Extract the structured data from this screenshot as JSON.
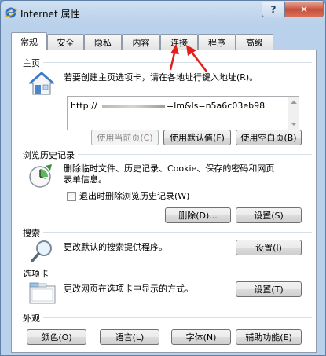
{
  "window": {
    "title": "Internet 属性",
    "help_label": "?",
    "close_label": "✕"
  },
  "tabs": [
    {
      "label": "常规",
      "active": true
    },
    {
      "label": "安全",
      "active": false
    },
    {
      "label": "隐私",
      "active": false
    },
    {
      "label": "内容",
      "active": false
    },
    {
      "label": "连接",
      "active": false
    },
    {
      "label": "程序",
      "active": false
    },
    {
      "label": "高级",
      "active": false
    }
  ],
  "home": {
    "section_title": "主页",
    "description": "若要创建主页选项卡，请在各地址行键入地址(R)。",
    "url_prefix": "http://",
    "url_suffix": "=lm&ls=n5a6c03eb98",
    "btn_current": "使用当前页(C)",
    "btn_default": "使用默认值(F)",
    "btn_blank": "使用空白页(B)"
  },
  "history": {
    "section_title": "浏览历史记录",
    "description_line1": "删除临时文件、历史记录、Cookie、保存的密码和网页",
    "description_line2": "表单信息。",
    "checkbox_label": "退出时删除浏览历史记录(W)",
    "btn_delete": "删除(D)...",
    "btn_settings": "设置(S)"
  },
  "search": {
    "section_title": "搜索",
    "description": "更改默认的搜索提供程序。",
    "btn_settings": "设置(I)"
  },
  "tabs_section": {
    "section_title": "选项卡",
    "description": "更改网页在选项卡中显示的方式。",
    "btn_settings": "设置(T)"
  },
  "appearance": {
    "section_title": "外观",
    "btn_colors": "颜色(O)",
    "btn_languages": "语言(L)",
    "btn_fonts": "字体(N)",
    "btn_accessibility": "辅助功能(E)"
  },
  "colors": {
    "annotation_arrow": "#e0201b",
    "close_button": "#c7503b",
    "ie_blue": "#2a6fc9"
  }
}
